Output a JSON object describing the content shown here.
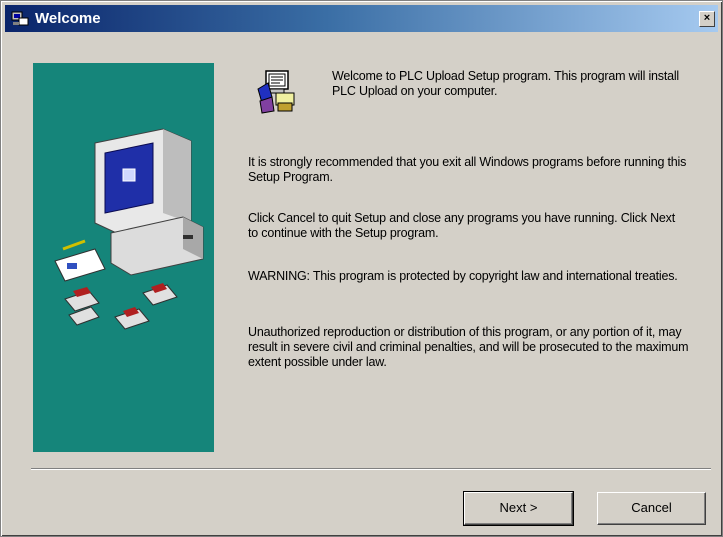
{
  "window": {
    "title": "Welcome",
    "close_label": "×"
  },
  "content": {
    "intro": "Welcome to PLC Upload Setup program. This program will install PLC Upload on your computer.",
    "recommend": "It is strongly recommended that you exit all Windows programs before running this Setup Program.",
    "cancel_info": "Click Cancel to quit Setup and close any programs you have running. Click Next to continue with the Setup program.",
    "warning": "WARNING: This program is protected by copyright law and international treaties.",
    "unauthorized": "Unauthorized reproduction or distribution of this program, or any portion of it, may result in severe civil and criminal penalties, and will be prosecuted to the maximum extent possible under law."
  },
  "buttons": {
    "next_label": "Next >",
    "cancel_label": "Cancel"
  },
  "icons": {
    "title": "setup-icon",
    "intro": "setup-computer-icon",
    "side": "computer-illustration"
  },
  "colors": {
    "side_panel": "#15857a",
    "title_start": "#0a246a",
    "title_end": "#a6caf0",
    "face": "#d4d0c8"
  }
}
